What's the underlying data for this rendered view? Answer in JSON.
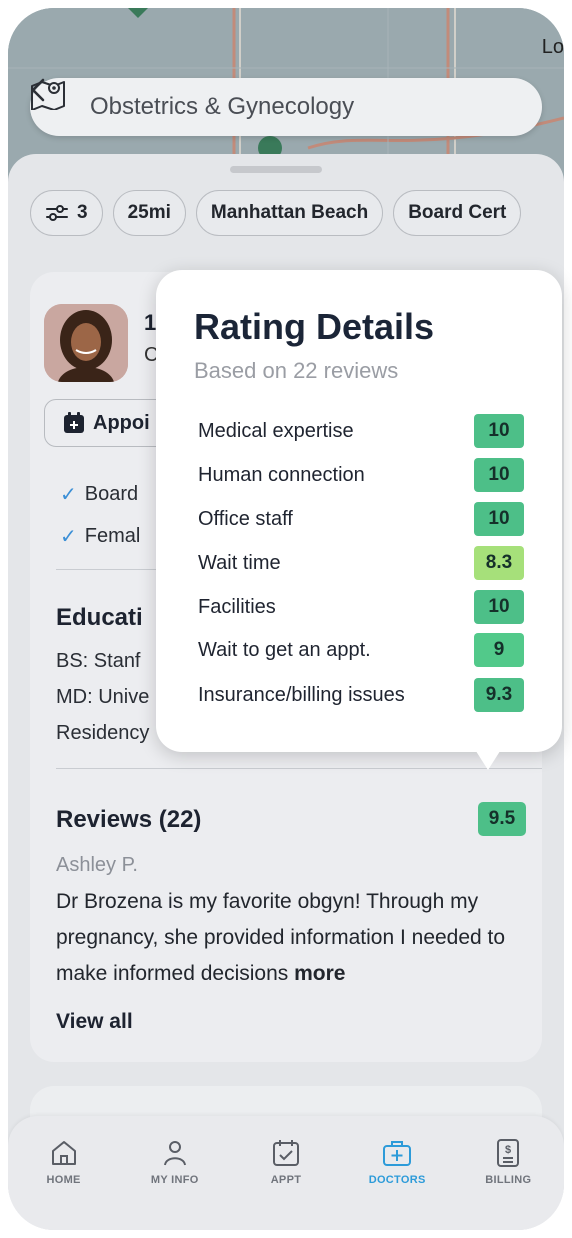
{
  "header": {
    "title": "Obstetrics & Gynecology",
    "map_label": "Lo"
  },
  "filters": {
    "chips": [
      "3",
      "25mi",
      "Manhattan Beach",
      "Board Cert"
    ]
  },
  "doctor": {
    "name_fragment": "1",
    "specialty_fragment": "C",
    "appointment_button": "Appoi",
    "checks": [
      "Board",
      "Femal"
    ]
  },
  "education": {
    "title": "Educati",
    "lines": [
      "BS: Stanf",
      "MD: Unive",
      "Residency"
    ]
  },
  "reviews": {
    "title": "Reviews (22)",
    "score": "9.5",
    "reviewer": "Ashley P.",
    "text": "Dr Brozena is my favorite obgyn! Through my pregnancy, she provided information I needed to make informed decisions",
    "more": "more",
    "view_all": "View all"
  },
  "rating_popover": {
    "title": "Rating Details",
    "subtitle": "Based on 22 reviews",
    "rows": [
      {
        "label": "Medical expertise",
        "score": "10",
        "color": "#4dbf88"
      },
      {
        "label": "Human connection",
        "score": "10",
        "color": "#4dbf88"
      },
      {
        "label": "Office staff",
        "score": "10",
        "color": "#4dbf88"
      },
      {
        "label": "Wait time",
        "score": "8.3",
        "color": "#a6e07a"
      },
      {
        "label": "Facilities",
        "score": "10",
        "color": "#4dbf88"
      },
      {
        "label": "Wait to get an appt.",
        "score": "9",
        "color": "#52c98a"
      },
      {
        "label": "Insurance/billing issues",
        "score": "9.3",
        "color": "#4dbf88"
      }
    ]
  },
  "tabbar": {
    "tabs": [
      {
        "label": "HOME",
        "icon": "home-icon"
      },
      {
        "label": "MY INFO",
        "icon": "person-icon"
      },
      {
        "label": "APPT",
        "icon": "calendar-check-icon"
      },
      {
        "label": "DOCTORS",
        "icon": "medical-kit-icon",
        "active": true
      },
      {
        "label": "BILLING",
        "icon": "bill-icon"
      }
    ],
    "active_color": "#2d9bd9"
  }
}
